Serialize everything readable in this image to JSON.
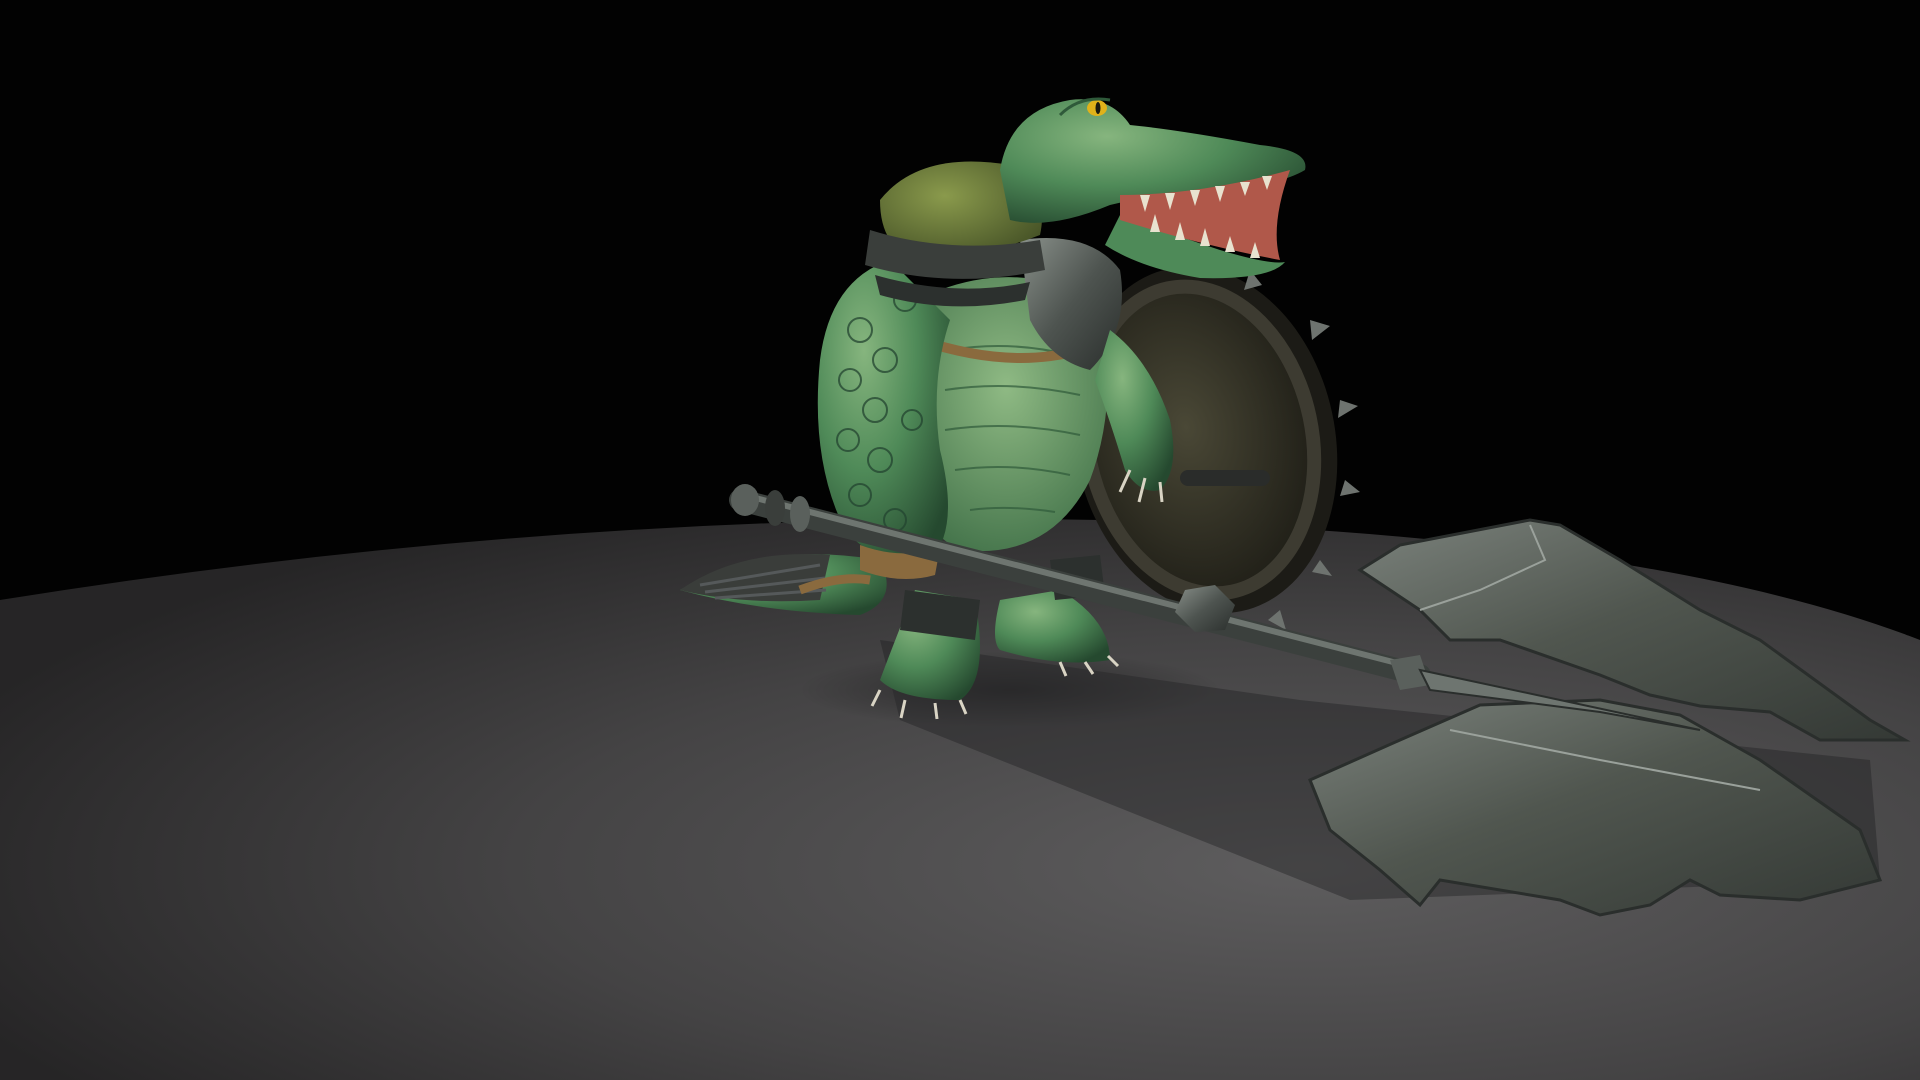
{
  "scene": {
    "subject": "crocodile-warrior-3d-model",
    "colors": {
      "background": "#020202",
      "floor_light": "#5a5a5a",
      "floor_dark": "#2a2a2a",
      "skin_dark": "#2f5a3a",
      "skin_mid": "#4e8a58",
      "skin_light": "#7fb27a",
      "armor_green": "#6a7a3a",
      "metal_dark": "#2c302e",
      "metal_mid": "#5a605c",
      "metal_light": "#8d948e",
      "leather": "#8a6a3e",
      "eye": "#e0b21a",
      "teeth": "#e8e2cf",
      "mouth": "#b0584a",
      "shield_face": "#3e3c2a"
    }
  }
}
